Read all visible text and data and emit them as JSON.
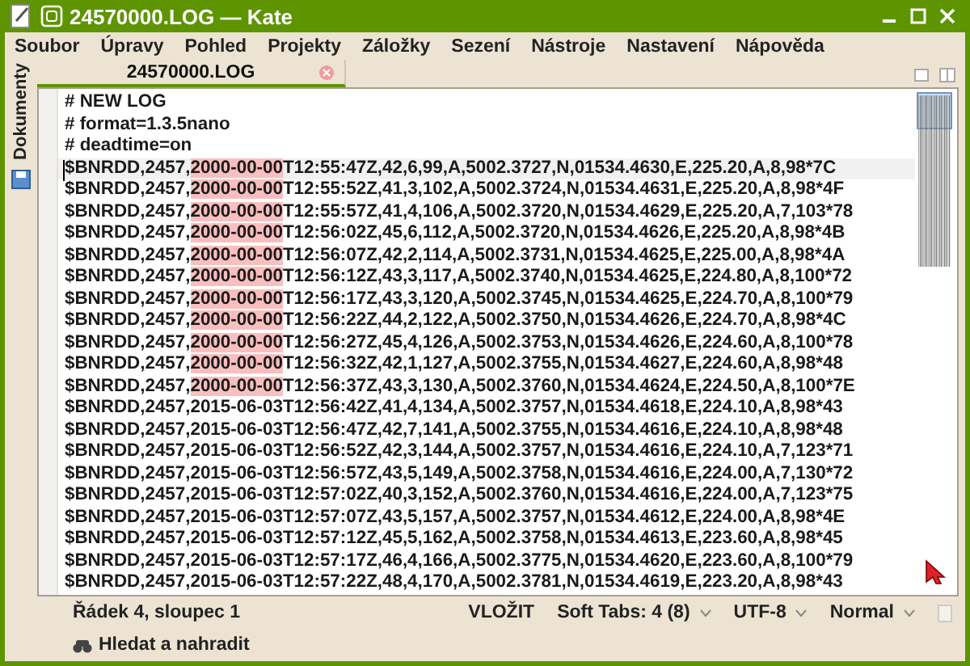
{
  "window": {
    "title": "24570000.LOG — Kate"
  },
  "menu": [
    "Soubor",
    "Úpravy",
    "Pohled",
    "Projekty",
    "Záložky",
    "Sezení",
    "Nástroje",
    "Nastavení",
    "Nápověda"
  ],
  "sidebar": {
    "label": "Dokumenty"
  },
  "tabs": [
    {
      "label": "24570000.LOG",
      "selected": true
    }
  ],
  "editor": {
    "lines": [
      {
        "current": false,
        "segments": [
          {
            "text": "# NEW LOG",
            "highlighted": false
          }
        ]
      },
      {
        "current": false,
        "segments": [
          {
            "text": "# format=1.3.5nano",
            "highlighted": false
          }
        ]
      },
      {
        "current": false,
        "segments": [
          {
            "text": "# deadtime=on",
            "highlighted": false
          }
        ]
      },
      {
        "current": true,
        "segments": [
          {
            "text": "$BNRDD,2457,",
            "highlighted": false
          },
          {
            "text": "2000-00-00",
            "highlighted": true
          },
          {
            "text": "T12:55:47Z,42,6,99,A,5002.3727,N,01534.4630,E,225.20,A,8,98*7C",
            "highlighted": false
          }
        ]
      },
      {
        "current": false,
        "segments": [
          {
            "text": "$BNRDD,2457,",
            "highlighted": false
          },
          {
            "text": "2000-00-00",
            "highlighted": true
          },
          {
            "text": "T12:55:52Z,41,3,102,A,5002.3724,N,01534.4631,E,225.20,A,8,98*4F",
            "highlighted": false
          }
        ]
      },
      {
        "current": false,
        "segments": [
          {
            "text": "$BNRDD,2457,",
            "highlighted": false
          },
          {
            "text": "2000-00-00",
            "highlighted": true
          },
          {
            "text": "T12:55:57Z,41,4,106,A,5002.3720,N,01534.4629,E,225.20,A,7,103*78",
            "highlighted": false
          }
        ]
      },
      {
        "current": false,
        "segments": [
          {
            "text": "$BNRDD,2457,",
            "highlighted": false
          },
          {
            "text": "2000-00-00",
            "highlighted": true
          },
          {
            "text": "T12:56:02Z,45,6,112,A,5002.3720,N,01534.4626,E,225.20,A,8,98*4B",
            "highlighted": false
          }
        ]
      },
      {
        "current": false,
        "segments": [
          {
            "text": "$BNRDD,2457,",
            "highlighted": false
          },
          {
            "text": "2000-00-00",
            "highlighted": true
          },
          {
            "text": "T12:56:07Z,42,2,114,A,5002.3731,N,01534.4625,E,225.00,A,8,98*4A",
            "highlighted": false
          }
        ]
      },
      {
        "current": false,
        "segments": [
          {
            "text": "$BNRDD,2457,",
            "highlighted": false
          },
          {
            "text": "2000-00-00",
            "highlighted": true
          },
          {
            "text": "T12:56:12Z,43,3,117,A,5002.3740,N,01534.4625,E,224.80,A,8,100*72",
            "highlighted": false
          }
        ]
      },
      {
        "current": false,
        "segments": [
          {
            "text": "$BNRDD,2457,",
            "highlighted": false
          },
          {
            "text": "2000-00-00",
            "highlighted": true
          },
          {
            "text": "T12:56:17Z,43,3,120,A,5002.3745,N,01534.4625,E,224.70,A,8,100*79",
            "highlighted": false
          }
        ]
      },
      {
        "current": false,
        "segments": [
          {
            "text": "$BNRDD,2457,",
            "highlighted": false
          },
          {
            "text": "2000-00-00",
            "highlighted": true
          },
          {
            "text": "T12:56:22Z,44,2,122,A,5002.3750,N,01534.4626,E,224.70,A,8,98*4C",
            "highlighted": false
          }
        ]
      },
      {
        "current": false,
        "segments": [
          {
            "text": "$BNRDD,2457,",
            "highlighted": false
          },
          {
            "text": "2000-00-00",
            "highlighted": true
          },
          {
            "text": "T12:56:27Z,45,4,126,A,5002.3753,N,01534.4626,E,224.60,A,8,100*78",
            "highlighted": false
          }
        ]
      },
      {
        "current": false,
        "segments": [
          {
            "text": "$BNRDD,2457,",
            "highlighted": false
          },
          {
            "text": "2000-00-00",
            "highlighted": true
          },
          {
            "text": "T12:56:32Z,42,1,127,A,5002.3755,N,01534.4627,E,224.60,A,8,98*48",
            "highlighted": false
          }
        ]
      },
      {
        "current": false,
        "segments": [
          {
            "text": "$BNRDD,2457,",
            "highlighted": false
          },
          {
            "text": "2000-00-00",
            "highlighted": true
          },
          {
            "text": "T12:56:37Z,43,3,130,A,5002.3760,N,01534.4624,E,224.50,A,8,100*7E",
            "highlighted": false
          }
        ]
      },
      {
        "current": false,
        "segments": [
          {
            "text": "$BNRDD,2457,2015-06-03T12:56:42Z,41,4,134,A,5002.3757,N,01534.4618,E,224.10,A,8,98*43",
            "highlighted": false
          }
        ]
      },
      {
        "current": false,
        "segments": [
          {
            "text": "$BNRDD,2457,2015-06-03T12:56:47Z,42,7,141,A,5002.3755,N,01534.4616,E,224.10,A,8,98*48",
            "highlighted": false
          }
        ]
      },
      {
        "current": false,
        "segments": [
          {
            "text": "$BNRDD,2457,2015-06-03T12:56:52Z,42,3,144,A,5002.3757,N,01534.4616,E,224.10,A,7,123*71",
            "highlighted": false
          }
        ]
      },
      {
        "current": false,
        "segments": [
          {
            "text": "$BNRDD,2457,2015-06-03T12:56:57Z,43,5,149,A,5002.3758,N,01534.4616,E,224.00,A,7,130*72",
            "highlighted": false
          }
        ]
      },
      {
        "current": false,
        "segments": [
          {
            "text": "$BNRDD,2457,2015-06-03T12:57:02Z,40,3,152,A,5002.3760,N,01534.4616,E,224.00,A,7,123*75",
            "highlighted": false
          }
        ]
      },
      {
        "current": false,
        "segments": [
          {
            "text": "$BNRDD,2457,2015-06-03T12:57:07Z,43,5,157,A,5002.3757,N,01534.4612,E,224.00,A,8,98*4E",
            "highlighted": false
          }
        ]
      },
      {
        "current": false,
        "segments": [
          {
            "text": "$BNRDD,2457,2015-06-03T12:57:12Z,45,5,162,A,5002.3758,N,01534.4613,E,223.60,A,8,98*45",
            "highlighted": false
          }
        ]
      },
      {
        "current": false,
        "segments": [
          {
            "text": "$BNRDD,2457,2015-06-03T12:57:17Z,46,4,166,A,5002.3775,N,01534.4620,E,223.60,A,8,100*79",
            "highlighted": false
          }
        ]
      },
      {
        "current": false,
        "segments": [
          {
            "text": "$BNRDD,2457,2015-06-03T12:57:22Z,48,4,170,A,5002.3781,N,01534.4619,E,223.20,A,8,98*43",
            "highlighted": false
          }
        ]
      }
    ]
  },
  "status_bar": {
    "position": "Řádek 4, sloupec 1",
    "mode": "VLOŽIT",
    "dropdowns": [
      "Soft Tabs: 4 (8)",
      "UTF-8",
      "Normal"
    ]
  },
  "bottom_tool": {
    "label": "Hledat a nahradit"
  }
}
